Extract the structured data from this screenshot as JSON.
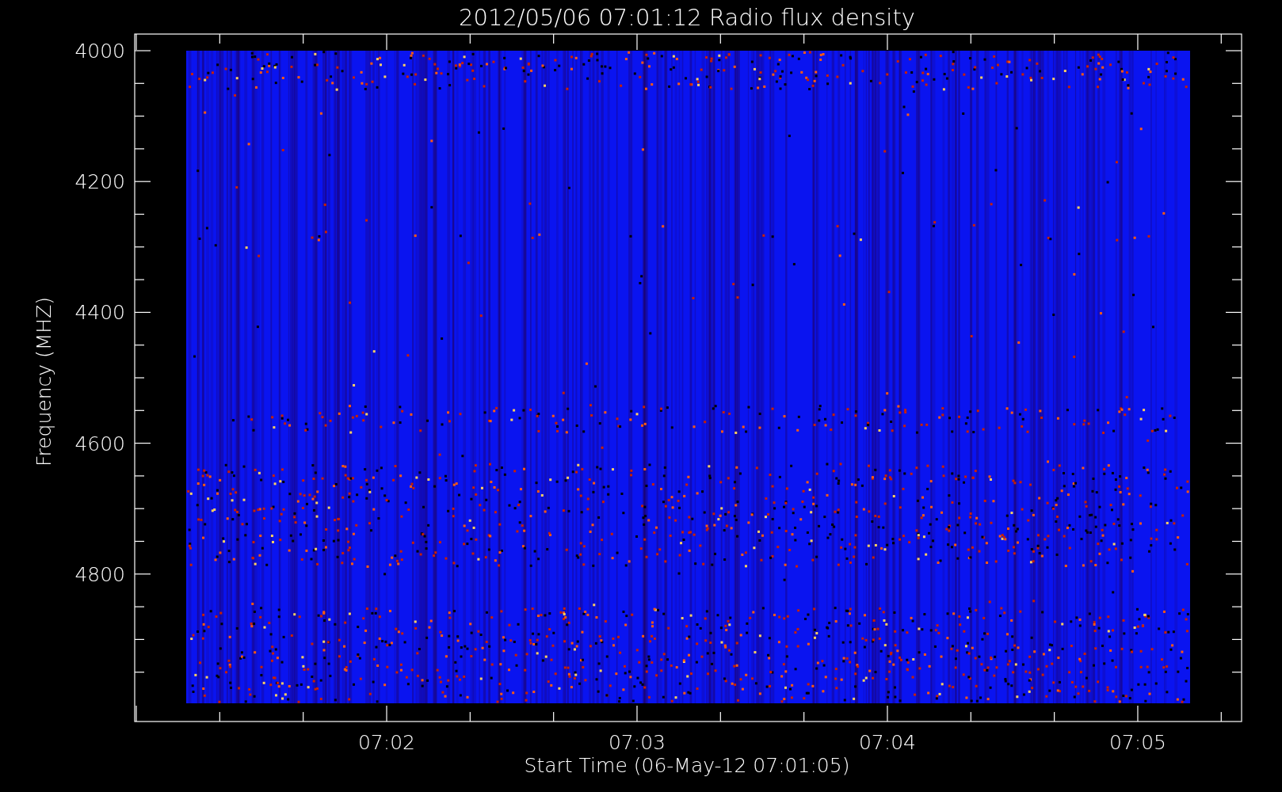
{
  "plot": {
    "title": "2012/05/06 07:01:12 Radio flux density",
    "ylabel": "Frequency (MHZ)",
    "xlabel": "Start Time (06-May-12 07:01:05)",
    "yticks": [
      "4000",
      "4200",
      "4400",
      "4600",
      "4800"
    ],
    "xticks": [
      "07:02",
      "07:03",
      "07:04",
      "07:05"
    ]
  }
}
